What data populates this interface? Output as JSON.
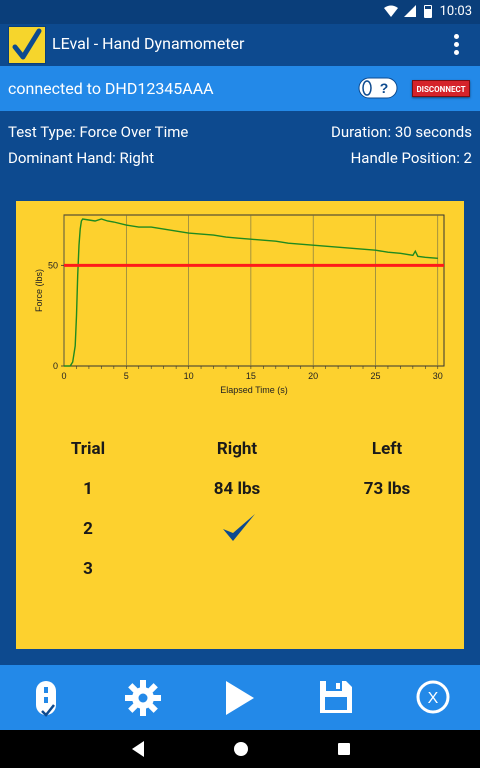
{
  "status_bar": {
    "time": "10:03"
  },
  "app_bar": {
    "title": "LEval - Hand Dynamometer"
  },
  "connection": {
    "status_text": "connected to DHD12345AAA",
    "disconnect_label": "DISCONNECT",
    "help_icon": "question-icon",
    "device_icon": "dynamometer-icon"
  },
  "test_info": {
    "test_type": "Test Type: Force Over Time",
    "duration": "Duration: 30 seconds",
    "dominant_hand": "Dominant Hand: Right",
    "handle_position": "Handle Position: 2"
  },
  "chart_data": {
    "type": "line",
    "xlabel": "Elapsed Time (s)",
    "ylabel": "Force (lbs)",
    "xlim": [
      0,
      30.5
    ],
    "ylim": [
      0,
      75
    ],
    "x_ticks": [
      "0",
      "5",
      "10",
      "15",
      "20",
      "25",
      "30"
    ],
    "y_ticks": [
      "0",
      "50"
    ],
    "threshold": {
      "value": 50,
      "color": "#ff1a1a"
    },
    "series": [
      {
        "color": "#1f8a1f",
        "x": [
          0,
          0.5,
          0.7,
          0.9,
          1.0,
          1.1,
          1.2,
          1.3,
          1.4,
          1.5,
          2,
          2.5,
          3,
          3.5,
          4,
          5,
          6,
          7,
          8,
          9,
          10,
          11,
          12,
          13,
          14,
          15,
          16,
          17,
          18,
          19,
          20,
          21,
          22,
          23,
          24,
          25,
          26,
          27,
          28,
          28.2,
          28.4,
          29,
          30
        ],
        "y": [
          0,
          0,
          2,
          10,
          25,
          45,
          60,
          68,
          72,
          73,
          72.5,
          72,
          73,
          72,
          71.5,
          70,
          69,
          69,
          68,
          67,
          66,
          65.5,
          65,
          64,
          63.5,
          63,
          62.5,
          62,
          61,
          60.5,
          60,
          59.5,
          59,
          58.5,
          58,
          57.5,
          56.5,
          56,
          55,
          57,
          54.5,
          54,
          53.5
        ]
      }
    ],
    "grid": true
  },
  "results": {
    "header_trial": "Trial",
    "header_right": "Right",
    "header_left": "Left",
    "rows": [
      {
        "trial": "1",
        "right": "84 lbs",
        "left": "73 lbs"
      },
      {
        "trial": "2",
        "right": "",
        "left": ""
      },
      {
        "trial": "3",
        "right": "",
        "left": ""
      }
    ],
    "current_marker_icon": "checkmark-icon"
  },
  "bottom_bar": {
    "icons": [
      "trial-list-icon",
      "settings-icon",
      "play-icon",
      "save-icon",
      "close-icon"
    ]
  }
}
